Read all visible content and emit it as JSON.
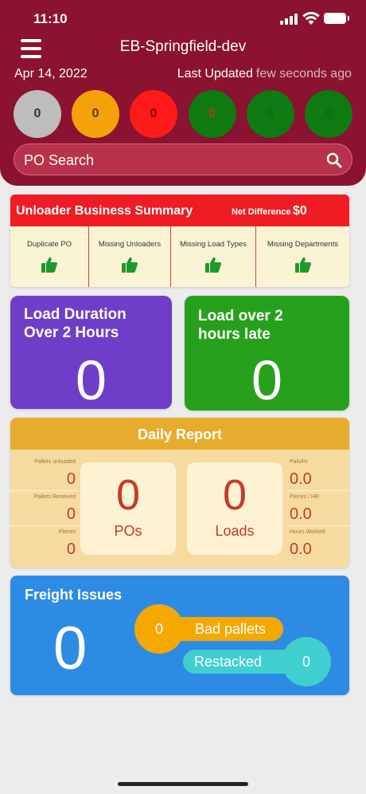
{
  "status_bar": {
    "time": "11:10"
  },
  "header": {
    "title": "EB-Springfield-dev",
    "date": "Apr 14, 2022",
    "last_updated_label": "Last Updated",
    "last_updated_value": "few seconds ago",
    "status_circles": [
      {
        "value": "0",
        "color": "#bdbdbd",
        "text_color": "#333333"
      },
      {
        "value": "0",
        "color": "#f5a20a",
        "text_color": "#5a3d00"
      },
      {
        "value": "0",
        "color": "#ff1a1a",
        "text_color": "#8a0000"
      },
      {
        "value": "0",
        "color": "#0e7a12",
        "text_color": "#b23c1e"
      },
      {
        "value": "0",
        "color": "#0e7a12",
        "text_color": "#13681a"
      },
      {
        "value": "0",
        "color": "#0e7a12",
        "text_color": "#13681a"
      }
    ],
    "search_placeholder": "PO Search"
  },
  "unloader_summary": {
    "title": "Unloader Business Summary",
    "net_difference_label": "Net Difference",
    "net_difference_value": "$0",
    "cells": [
      {
        "label": "Duplicate PO",
        "icon": "thumbs-up-icon"
      },
      {
        "label": "Missing Unloaders",
        "icon": "thumbs-up-icon"
      },
      {
        "label": "Missing Load Types",
        "icon": "thumbs-up-icon"
      },
      {
        "label": "Missing Departments",
        "icon": "thumbs-up-icon"
      }
    ]
  },
  "load_duration": {
    "title_line1": "Load Duration",
    "title_line2": "Over 2 Hours",
    "value": "0",
    "color": "#6f3ec9"
  },
  "load_late": {
    "title_line1": "Load over 2",
    "title_line2": "hours late",
    "value": "0",
    "color": "#27a11d"
  },
  "daily_report": {
    "title": "Daily Report",
    "left_metrics": [
      {
        "label": "Pallets unloaded",
        "value": "0"
      },
      {
        "label": "Pallets Received",
        "value": "0"
      },
      {
        "label": "Pieces",
        "value": "0"
      }
    ],
    "right_metrics": [
      {
        "label": "Pals/Hr",
        "value": "0.0"
      },
      {
        "label": "Pieces / HR",
        "value": "0.0"
      },
      {
        "label": "Hours Worked",
        "value": "0.0"
      }
    ],
    "pos": {
      "value": "0",
      "label": "POs"
    },
    "loads": {
      "value": "0",
      "label": "Loads"
    }
  },
  "freight_issues": {
    "title": "Freight Issues",
    "value": "0",
    "bad_pallets": {
      "label": "Bad pallets",
      "value": "0",
      "color": "#f5a800"
    },
    "restacked": {
      "label": "Restacked",
      "value": "0",
      "color": "#3fcfcf"
    }
  }
}
